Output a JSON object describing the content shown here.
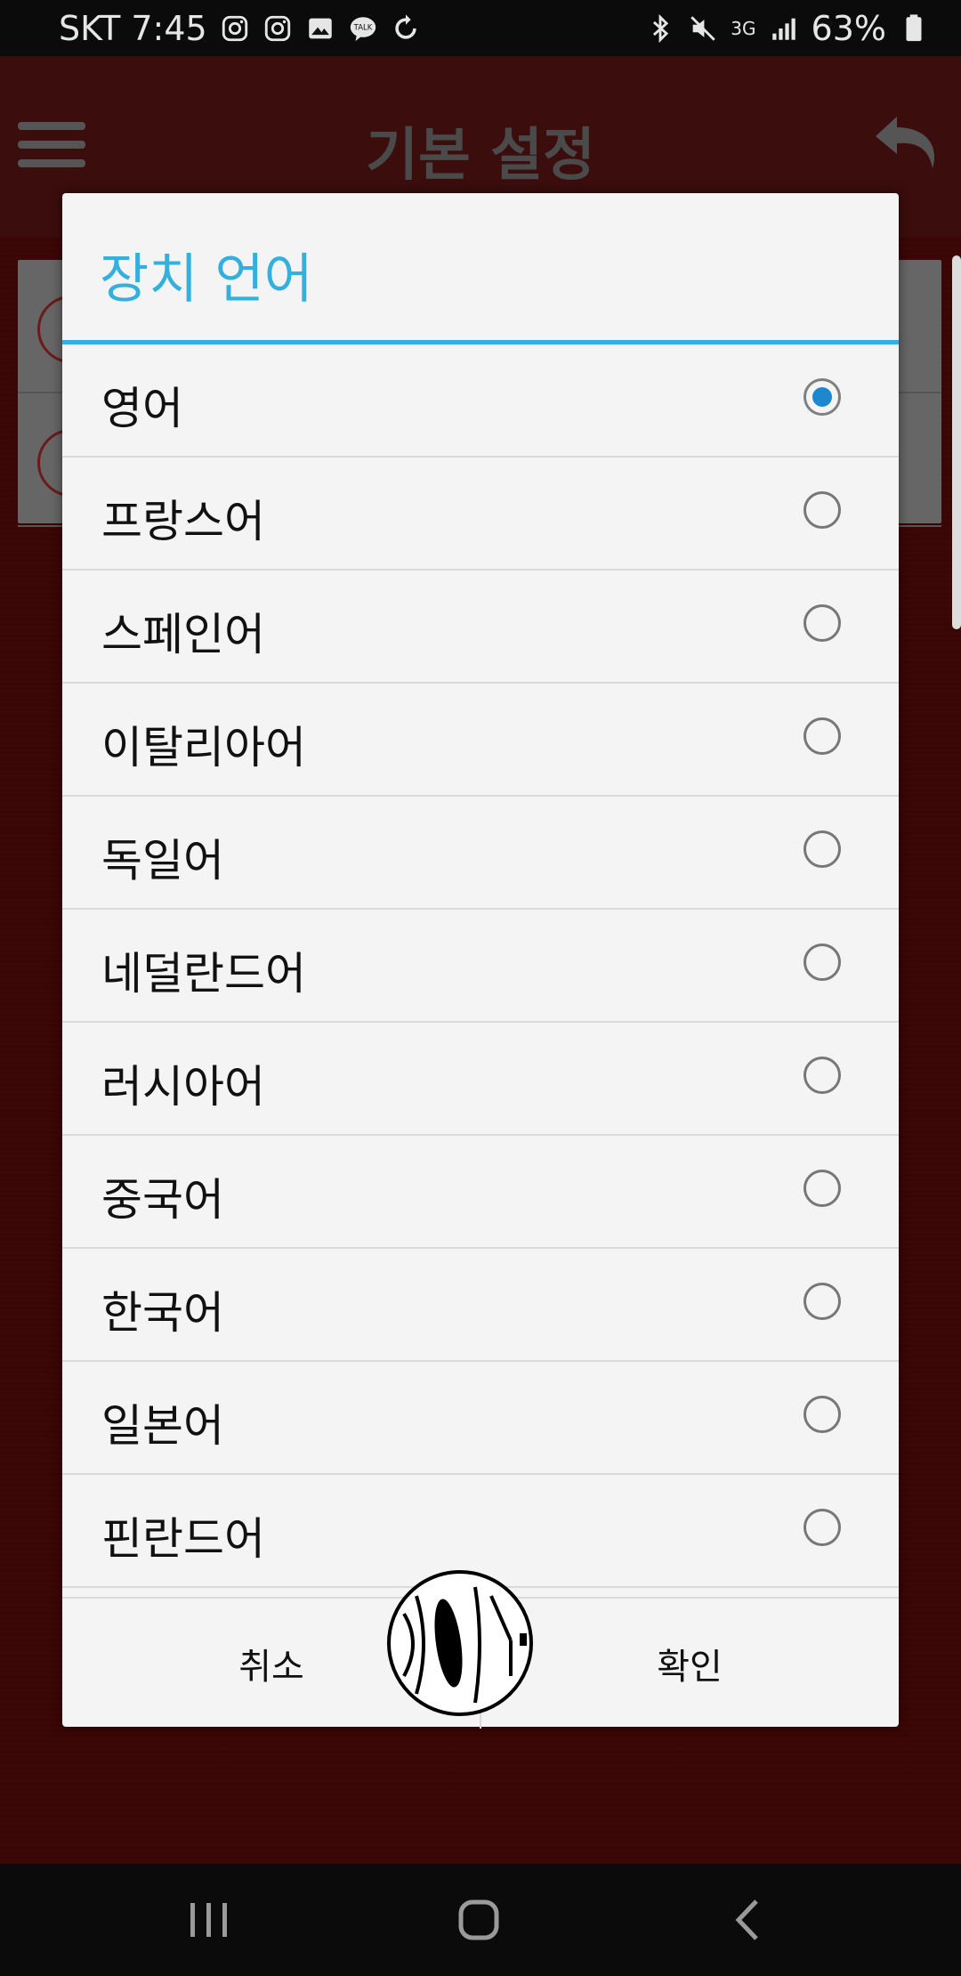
{
  "status_bar": {
    "carrier_time": "SKT 7:45",
    "network": "3G",
    "battery": "63%",
    "icons_left": [
      "instagram-icon",
      "instagram-icon",
      "gallery-icon",
      "talk-icon",
      "sync-icon"
    ],
    "icons_right": [
      "bluetooth-icon",
      "mute-icon",
      "signal-icon",
      "battery-icon"
    ]
  },
  "app_bar": {
    "title": "기본 설정"
  },
  "dialog": {
    "title": "장치 언어",
    "accent_color": "#33b0dc",
    "options": [
      {
        "label": "영어",
        "selected": true
      },
      {
        "label": "프랑스어",
        "selected": false
      },
      {
        "label": "스페인어",
        "selected": false
      },
      {
        "label": "이탈리아어",
        "selected": false
      },
      {
        "label": "독일어",
        "selected": false
      },
      {
        "label": "네덜란드어",
        "selected": false
      },
      {
        "label": "러시아어",
        "selected": false
      },
      {
        "label": "중국어",
        "selected": false
      },
      {
        "label": "한국어",
        "selected": false
      },
      {
        "label": "일본어",
        "selected": false
      },
      {
        "label": "핀란드어",
        "selected": false
      }
    ],
    "cancel_label": "취소",
    "ok_label": "확인"
  },
  "nav_bar": {
    "buttons": [
      "recents-icon",
      "home-icon",
      "back-icon"
    ]
  }
}
